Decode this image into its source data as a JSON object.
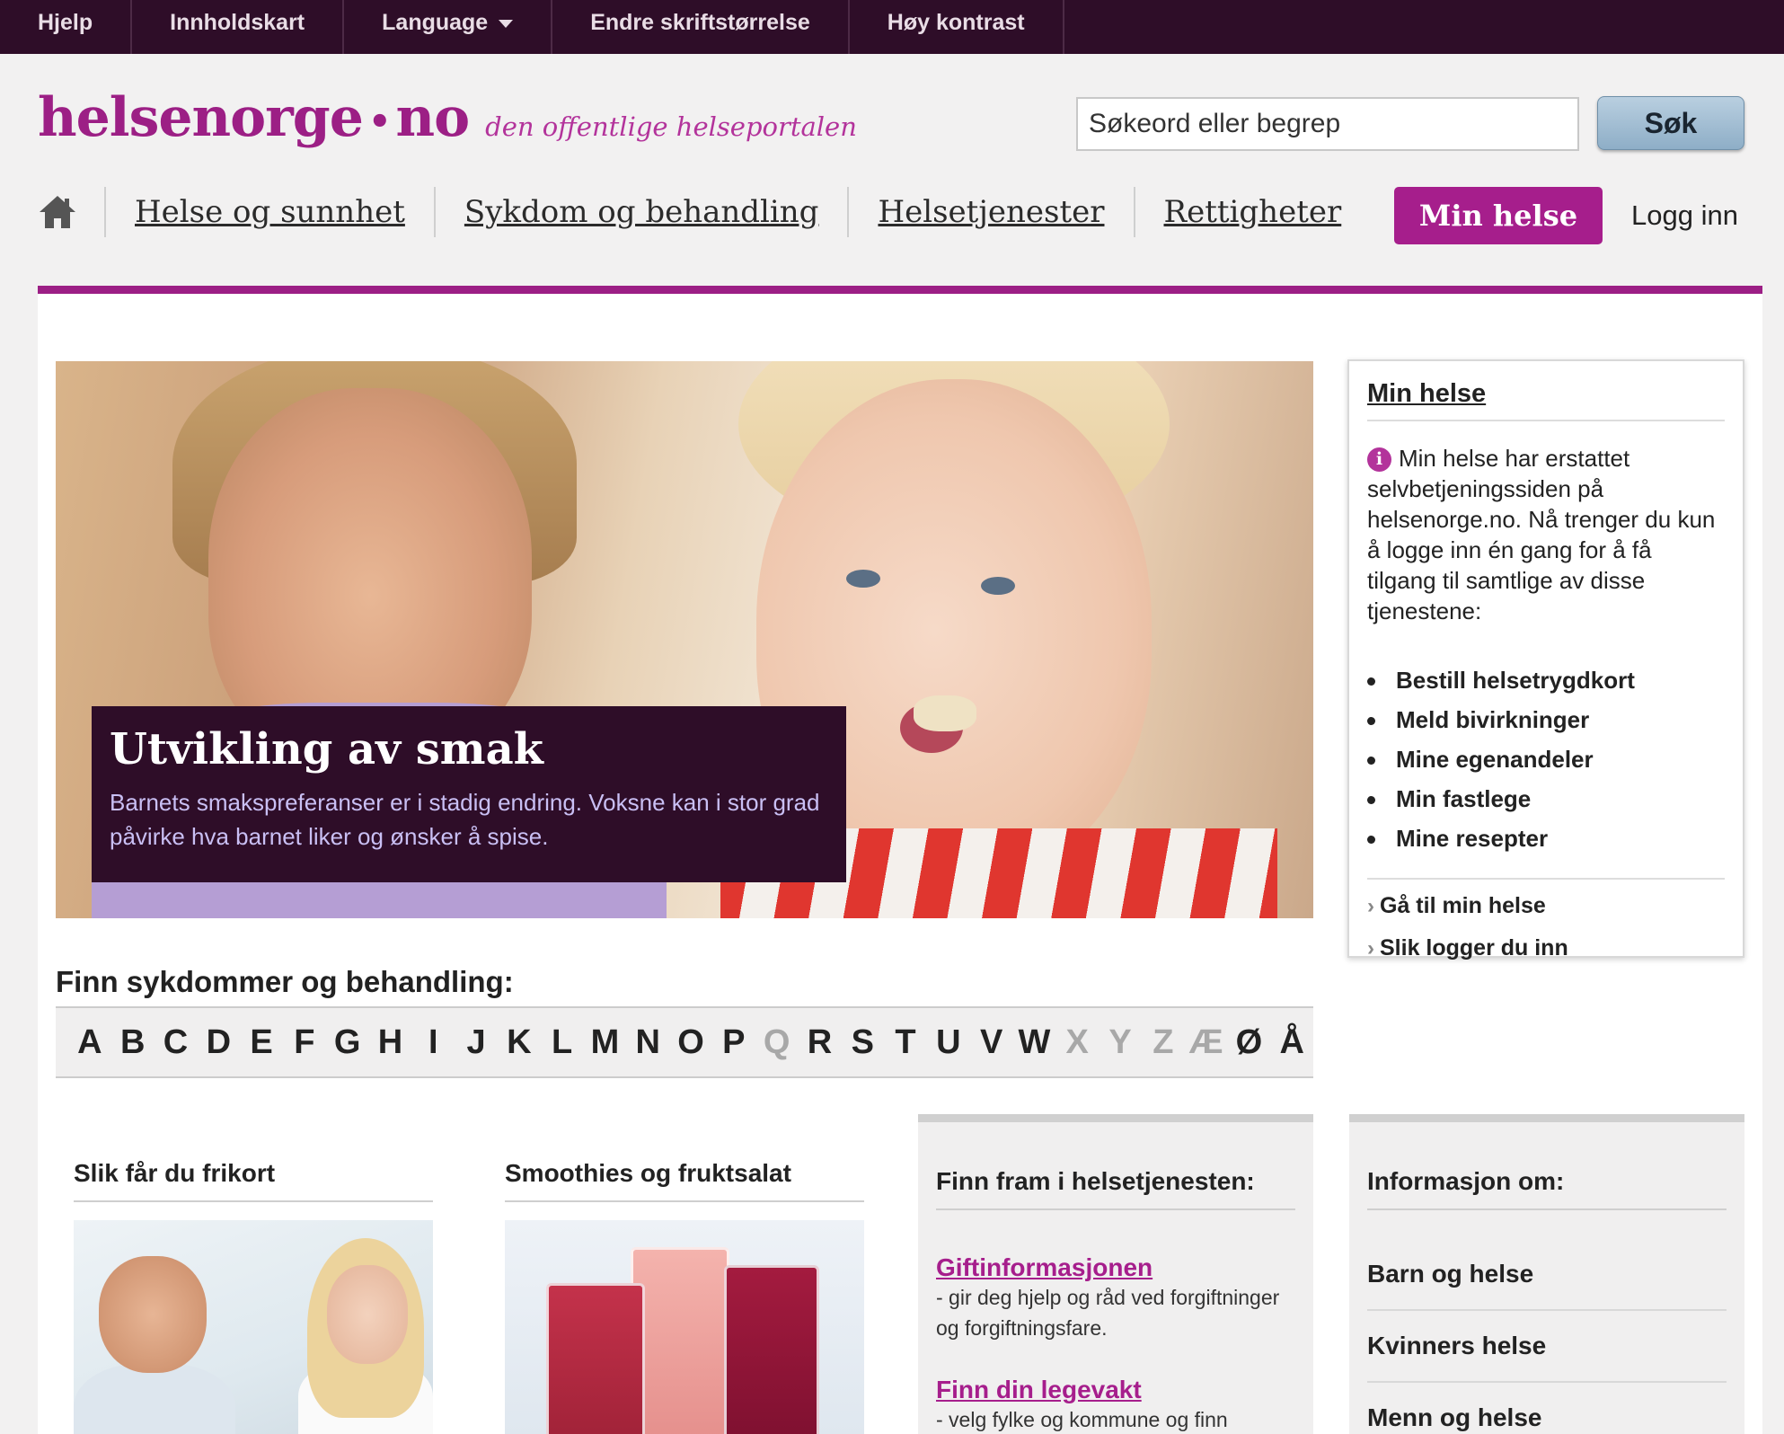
{
  "topbar": {
    "items": [
      "Hjelp",
      "Innholdskart",
      "Language",
      "Endre skriftstørrelse",
      "Høy kontrast"
    ]
  },
  "header": {
    "brand_main": "helsenorge",
    "brand_dot": "•",
    "brand_tld": "no",
    "tagline": "den offentlige helseportalen",
    "search_placeholder": "Søkeord eller begrep",
    "search_button": "Søk"
  },
  "nav": {
    "links": [
      "Helse og sunnhet",
      "Sykdom og behandling",
      "Helsetjenester",
      "Rettigheter"
    ],
    "min_helse_button": "Min helse",
    "login": "Logg inn"
  },
  "hero": {
    "title": "Utvikling av smak",
    "text": "Barnets smakspreferanser er i stadig endring. Voksne kan i stor grad påvirke hva barnet liker og ønsker å spise."
  },
  "min_helse_box": {
    "title": "Min helse",
    "info_glyph": "i",
    "info_text": "Min helse har erstattet selvbetjeningssiden på helsenorge.no. Nå trenger du kun å logge inn én gang for å få tilgang til samtlige av disse tjenestene:",
    "services": [
      "Bestill helsetrygdkort",
      "Meld bivirkninger",
      "Mine egenandeler",
      "Min fastlege",
      "Mine resepter"
    ],
    "links": [
      "Gå til min helse",
      "Slik logger du inn"
    ],
    "chevron": "›"
  },
  "az": {
    "title": "Finn sykdommer og behandling:",
    "letters": [
      "A",
      "B",
      "C",
      "D",
      "E",
      "F",
      "G",
      "H",
      "I",
      "J",
      "K",
      "L",
      "M",
      "N",
      "O",
      "P",
      "Q",
      "R",
      "S",
      "T",
      "U",
      "V",
      "W",
      "X",
      "Y",
      "Z",
      "Æ",
      "Ø",
      "Å"
    ],
    "disabled": [
      "Q",
      "X",
      "Y",
      "Z",
      "Æ"
    ]
  },
  "cards": {
    "frikort_title": "Slik får du frikort",
    "smoothie_title": "Smoothies og fruktsalat",
    "services_title": "Finn fram i helsetjenesten:",
    "services": [
      {
        "link": "Giftinformasjonen",
        "desc": "- gir deg hjelp og råd ved forgiftninger og forgiftningsfare."
      },
      {
        "link": "Finn din legevakt",
        "desc": "- velg fylke og kommune og finn"
      }
    ],
    "info_title": "Informasjon om:",
    "info_items": [
      "Barn og helse",
      "Kvinners helse",
      "Menn og helse"
    ]
  },
  "colors": {
    "accent": "#9c1f85",
    "topbar": "#2e0d28",
    "button_purple": "#a61e8c"
  }
}
